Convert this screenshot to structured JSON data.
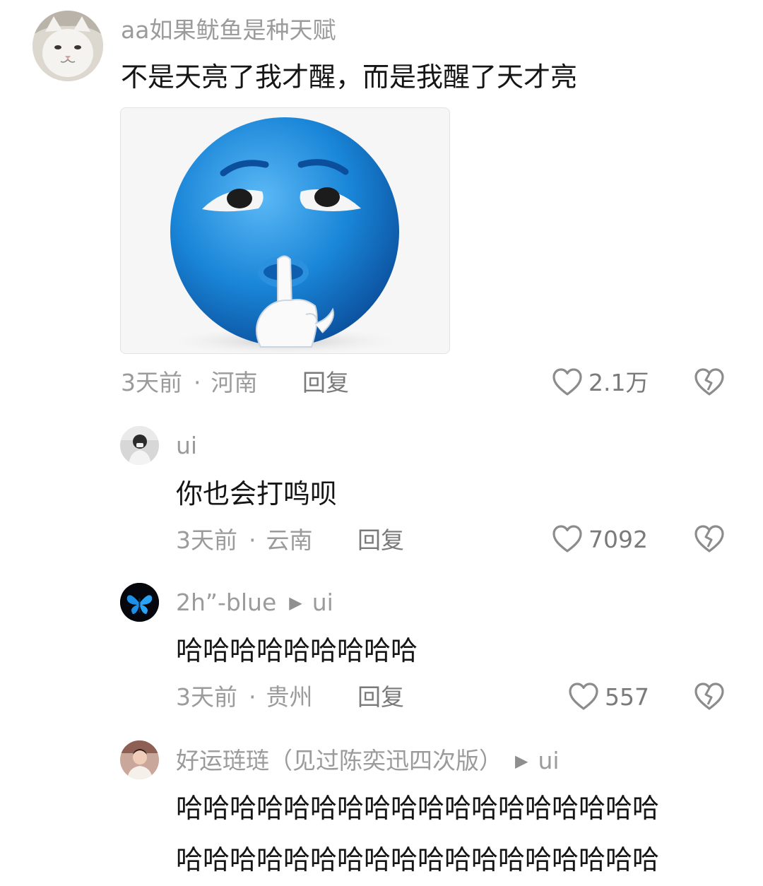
{
  "comments": [
    {
      "username": "aa如果鱿鱼是种天赋",
      "text": "不是天亮了我才醒，而是我醒了天才亮",
      "time": "3天前",
      "location": "河南",
      "reply_label": "回复",
      "likes": "2.1万",
      "avatar_icon": "cat-avatar",
      "image_icon": "blue-shush-emoji"
    },
    {
      "username": "ui",
      "text": "你也会打鸣呗",
      "time": "3天前",
      "location": "云南",
      "reply_label": "回复",
      "likes": "7092",
      "avatar_icon": "person-avatar"
    },
    {
      "username": "2h”-blue",
      "reply_to": "ui",
      "text": "哈哈哈哈哈哈哈哈哈",
      "time": "3天前",
      "location": "贵州",
      "reply_label": "回复",
      "likes": "557",
      "avatar_icon": "butterfly-avatar"
    },
    {
      "username": "好运琏琏（见过陈奕迅四次版）",
      "reply_to": "ui",
      "text_lines": [
        "哈哈哈哈哈哈哈哈哈哈哈哈哈哈哈哈哈哈",
        "哈哈哈哈哈哈哈哈哈哈哈哈哈哈哈哈哈哈"
      ],
      "avatar_icon": "person-avatar"
    }
  ],
  "colors": {
    "text": "#151515",
    "secondary": "#9b9b9b",
    "emoji_blue": "#1a86d8"
  }
}
